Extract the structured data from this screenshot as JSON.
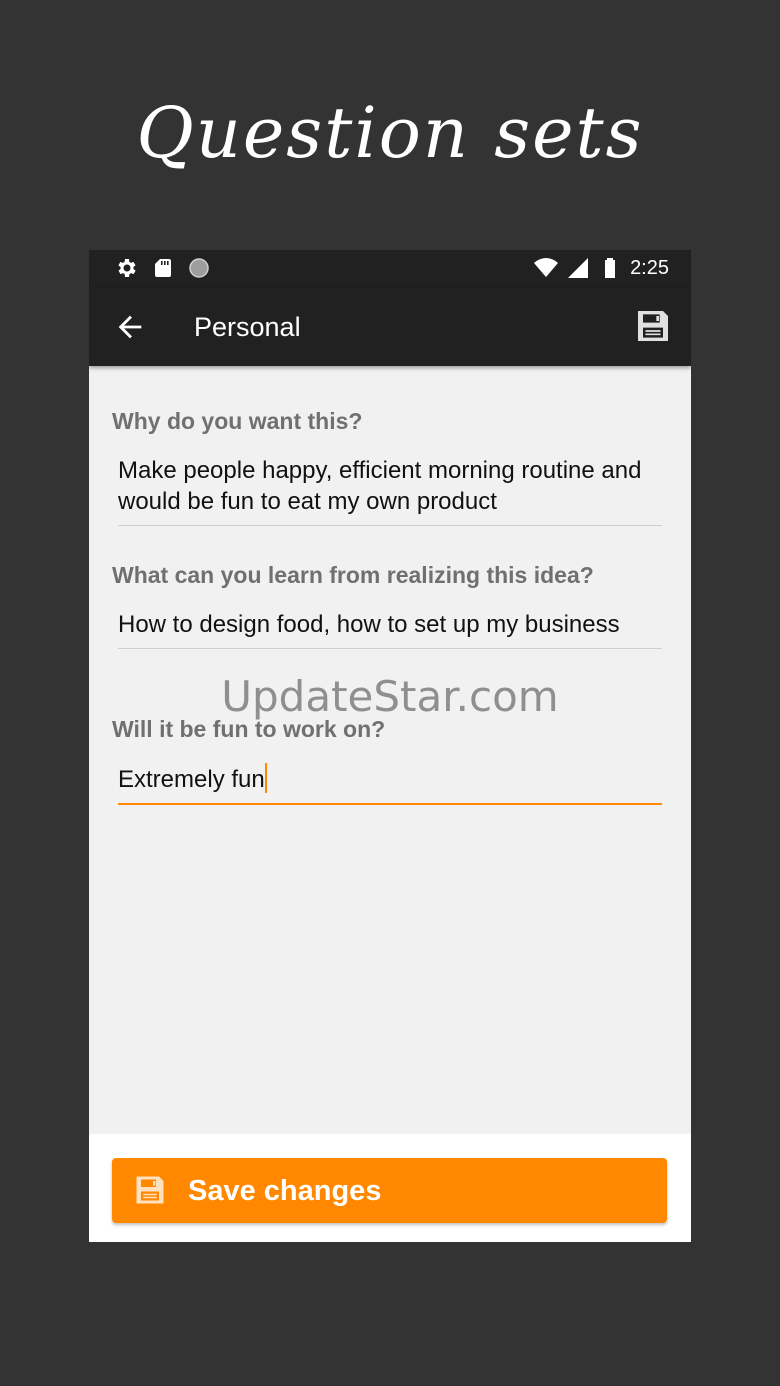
{
  "promo": {
    "title": "Question sets"
  },
  "status_bar": {
    "time": "2:25",
    "icons": [
      "gear-icon",
      "sd-card-icon",
      "record-icon",
      "wifi-icon",
      "signal-icon",
      "battery-icon"
    ]
  },
  "toolbar": {
    "title": "Personal",
    "back_icon": "arrow-left-icon",
    "save_icon": "floppy-disk-icon"
  },
  "questions": [
    {
      "label": "Why do you want this?",
      "answer": "Make people happy, efficient morning routine and would be fun to eat my own product"
    },
    {
      "label": "What can you learn from realizing this idea?",
      "answer": "How to design food, how to set up my business"
    },
    {
      "label": "Will it be fun to work on?",
      "answer": "Extremely fun"
    }
  ],
  "save_button": {
    "label": "Save changes",
    "icon": "floppy-disk-icon"
  },
  "watermark": "UpdateStar.com",
  "colors": {
    "accent": "#ff8800",
    "toolbar": "#212121",
    "background": "#333333",
    "content": "#f1f1f1"
  }
}
